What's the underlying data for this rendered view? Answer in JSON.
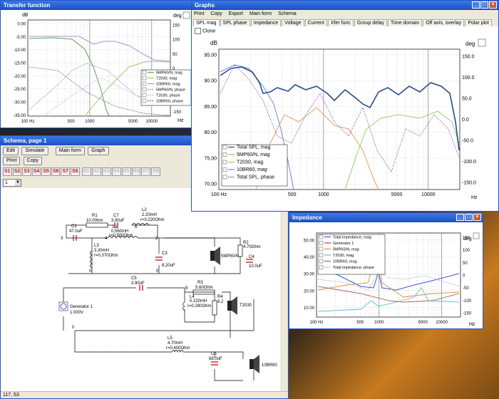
{
  "transfer": {
    "title": "Transfer function",
    "ylabel": "dB",
    "y2label": "deg",
    "yticks": [
      "0.00",
      "-5.00",
      "-10.00",
      "-15.00",
      "-20.00",
      "-25.00",
      "-30.00",
      "-35.00"
    ],
    "y2ticks": [
      "150",
      "100",
      "50",
      "0",
      "-50",
      "-100",
      "-150"
    ],
    "xticks": [
      "100 Hz",
      "500",
      "1000",
      "5000",
      "10000"
    ],
    "xunit": "Hz",
    "legend": [
      "5MP60/N, mag",
      "T2030, mag",
      "10BR60, mag",
      "5MP60/N, phase",
      "T2030, phase",
      "10BR60, phase"
    ]
  },
  "graphs": {
    "title": "Graphs",
    "menu": [
      "Print",
      "Copy",
      "Export",
      "Main form",
      "Schema"
    ],
    "tabs": [
      "SPL mag",
      "SPL phase",
      "Impedance",
      "Voltage",
      "Current",
      "Xfer func",
      "Group delay",
      "Time domain",
      "Off axis, overlay",
      "Polar plot"
    ],
    "clone_label": "Clone",
    "ylabel": "dB",
    "y2label": "deg",
    "yticks": [
      "95.00",
      "90.00",
      "85.00",
      "80.00",
      "75.00",
      "70.00"
    ],
    "y2ticks": [
      "150.0",
      "100.0",
      "50.0",
      "0.0",
      "-50.0",
      "-100.0",
      "-150.0"
    ],
    "xticks": [
      "100 Hz",
      "500",
      "1000",
      "5000",
      "10000"
    ],
    "xunit": "Hz",
    "legend": [
      "Total SPL, mag",
      "5MP60/N, mag",
      "T2030, mag",
      "10BR60, mag",
      "Total SPL, phase"
    ]
  },
  "schema": {
    "title": "Schema, page 1",
    "toolbar": [
      "Edit",
      "Simulate",
      "Main form",
      "Graph"
    ],
    "print_label": "Print",
    "copy_label": "Copy",
    "pages_on": [
      "S1",
      "S2",
      "S3",
      "S4",
      "S5",
      "S6",
      "S7",
      "S8"
    ],
    "pages_off": [
      "R1",
      "R2",
      "R3",
      "R4",
      "R5",
      "R6",
      "R7",
      "R8"
    ],
    "page_select": "1",
    "components": {
      "r1": "R1",
      "r1v": "10.00hm",
      "c7": "C7",
      "c7v": "3.90uF",
      "l2": "L2",
      "l2v": "2.20mH",
      "l2r": "r=0.220Ohm",
      "c1": "C1",
      "c1v": "47.0uF",
      "l1": "L1",
      "l1v": "0.560mH",
      "l1r": "r=0.500Ohm",
      "l3": "L3",
      "l3v": "3.30mH",
      "l3r": "r=0.370Ohm",
      "c3": "C3",
      "c3v": "8.20uF",
      "r2": "R2",
      "r2v": "4.70Ohm",
      "c4": "C4",
      "c4v": "10.0uF",
      "spk1": "5MP60/N",
      "c5": "C5",
      "c5v": "3.90uF",
      "r3": "R3",
      "r3v": "5.60Ohm",
      "l4": "L4",
      "l4v": "0.220mH",
      "l4r": "r=0.280Ohm",
      "r4": "R4",
      "r4v": "8.2",
      "spk2": "T2030",
      "gen": "Generator 1",
      "genv": "1.000V",
      "l5": "L5",
      "l5v": "4.70mH",
      "l5r": "r=0.400Ohm",
      "c6": "C6",
      "c6v": "68.0uF",
      "spk3": "10BR60",
      "n3": "3",
      "n4": "4",
      "n2": "2",
      "n6": "6",
      "n9": "9",
      "n0a": "0",
      "n0b": "0",
      "n0c": "0"
    },
    "status": "117, 53"
  },
  "impedance": {
    "title": "Impedance",
    "y2label": "deg",
    "yticks": [
      "50.00",
      "40.00",
      "30.00",
      "20.00",
      "10.00"
    ],
    "y2ticks": [
      "150",
      "100",
      "50",
      "0",
      "-50",
      "-100",
      "-150"
    ],
    "xticks": [
      "100 Hz",
      "500",
      "1000",
      "5000",
      "10000"
    ],
    "xunit": "Hz",
    "legend": [
      "Total impedance, mag",
      "Generator 1",
      "5MP60/N, mag",
      "T2030, mag",
      "10BR60, mag",
      "Total impedance, phase"
    ]
  }
}
